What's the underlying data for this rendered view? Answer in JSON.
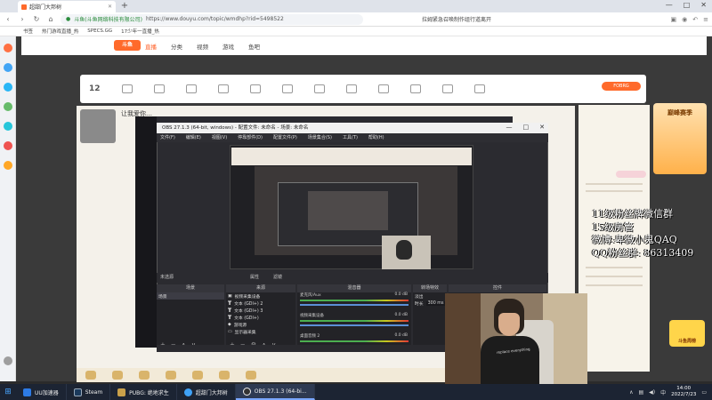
{
  "browser": {
    "tab_title": "超甜门大邦树",
    "new_tab": "+",
    "url_site": "斗鱼(斗鱼网络科技有限公司)",
    "url": "https://www.douyu.com/topic/wmdhp?rid=5498522",
    "news": "拉姆紧急召唤制作组行道离开",
    "bookmarks": [
      "书签",
      "热门游戏直播_热",
      "SPECS.GG",
      "17少年一直播_热"
    ],
    "window_controls": [
      "—",
      "□",
      "✕"
    ]
  },
  "douyu": {
    "logo": "斗鱼",
    "nav": [
      "首页",
      "直播",
      "分类",
      "视频",
      "游戏",
      "鱼吧"
    ],
    "active_nav": "直播",
    "level": "12",
    "fan_button": "FOBRG",
    "room_title": "让我爱你…"
  },
  "promo": "巅峰赛季",
  "badge": "斗鱼周榜",
  "obs": {
    "title": "OBS 27.1.3 (64-bit, windows) - 配置文件: 未命名 - 场景: 未命名",
    "menu": [
      "文件(F)",
      "编辑(E)",
      "视图(V)",
      "停靠部件(D)",
      "配置文件(P)",
      "场景集合(S)",
      "工具(T)",
      "帮助(H)"
    ],
    "preview_bar": [
      "未选源",
      "属性",
      "滤镜"
    ],
    "docks": {
      "scenes": "场景",
      "sources": "来源",
      "mixer": "混音器",
      "transitions": "转场特效",
      "controls": "控件"
    },
    "scene_item": "场景",
    "sources": [
      "视频采集设备",
      "文本 (GDI+) 2",
      "文本 (GDI+) 3",
      "文本 (GDI+)",
      "游戏源",
      "显示器采集"
    ],
    "mixer": [
      {
        "name": "麦克风/Aux",
        "db": "0.0 dB"
      },
      {
        "name": "视频采集设备",
        "db": "0.0 dB"
      },
      {
        "name": "桌面音频 2",
        "db": "0.0 dB"
      }
    ],
    "transition_label": "淡出",
    "duration": "时长",
    "duration_value": "300 ms",
    "status": "LIVE: 00:00:00   REC: 00:00:00"
  },
  "overlay": {
    "line1": "11级粉丝牌微信群",
    "line2": "15级房管",
    "line3": "微博:卑微小鬼QAQ",
    "line4_label": "QQ粉丝群:",
    "line4_value": "86313409"
  },
  "webcam_shirt": "replace everything",
  "taskbar": {
    "items": [
      "UU加速器",
      "Steam",
      "PUBG: 绝地求生",
      "超甜门大邦树",
      "OBS 27.1.3 (64-bi..."
    ],
    "active": "OBS 27.1.3 (64-bi...",
    "time": "14:00",
    "date": "2022/7/23"
  },
  "colors": {
    "accent": "#ff6a2b",
    "taskbar": "#1c2433",
    "obs_bg": "#2b2b30"
  }
}
